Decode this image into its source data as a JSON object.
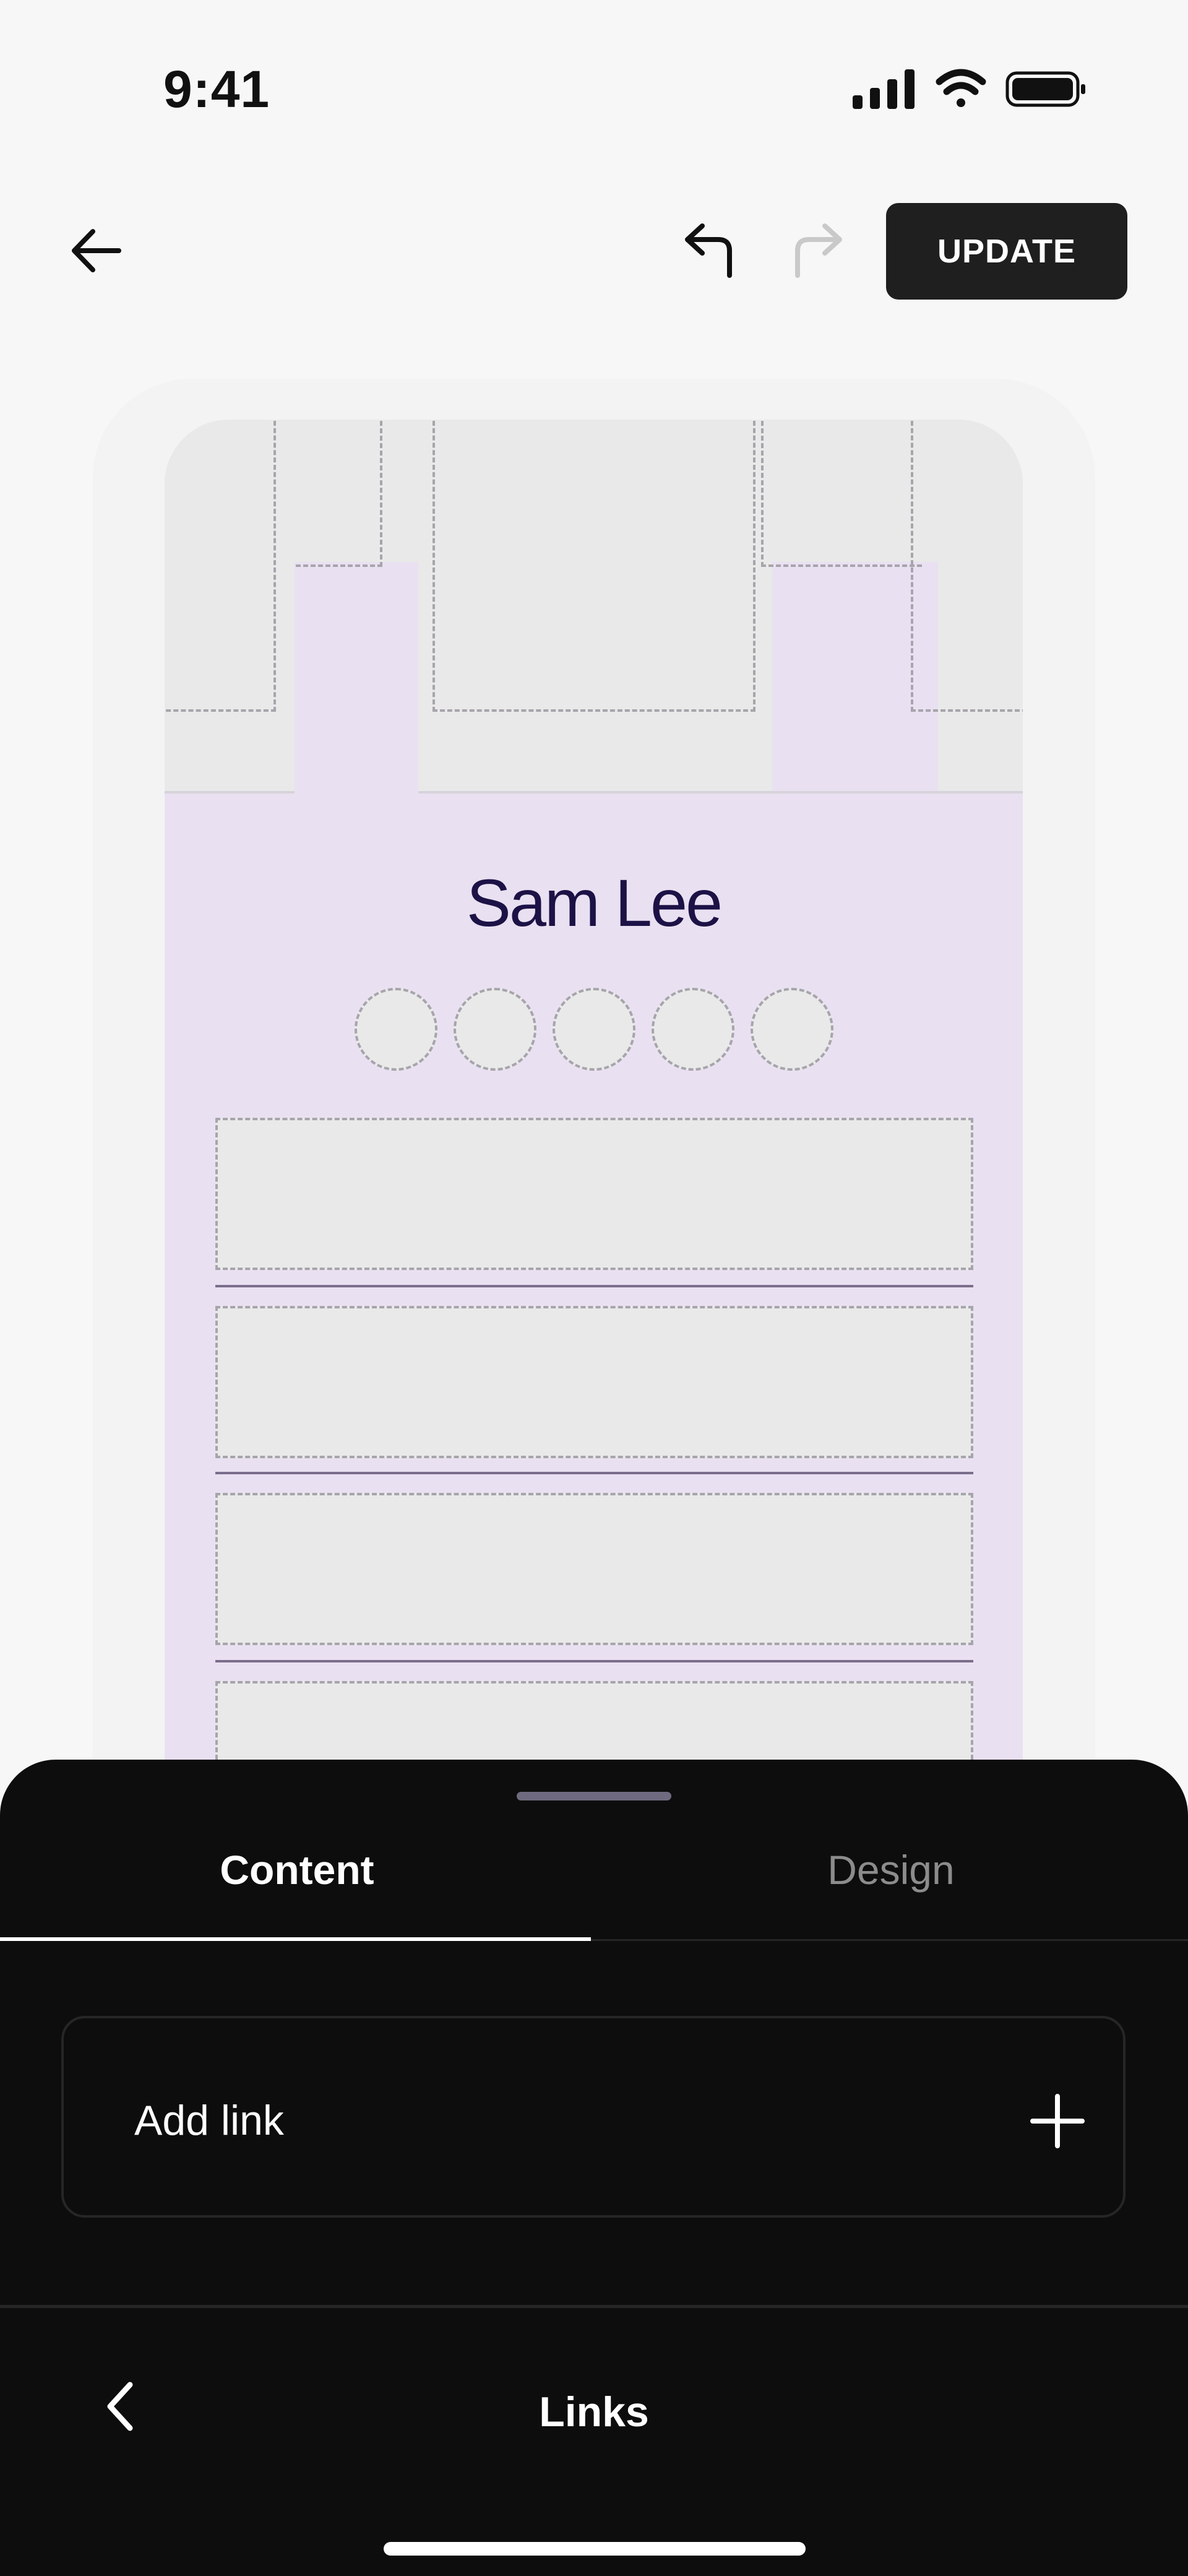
{
  "status_bar": {
    "time": "9:41",
    "icons": [
      "signal-icon",
      "wifi-icon",
      "battery-icon"
    ]
  },
  "toolbar": {
    "back_icon": "arrow-left-icon",
    "undo_icon": "undo-icon",
    "redo_icon": "redo-icon",
    "update_label": "UPDATE",
    "redo_enabled": false
  },
  "preview": {
    "profile_name": "Sam Lee",
    "social_placeholder_count": 5,
    "link_placeholder_count": 4,
    "colors": {
      "background": "#e9e0f2",
      "name": "#1c1246",
      "placeholder": "#e8e9e8",
      "dash": "#a8a4ab"
    }
  },
  "sheet": {
    "tabs": [
      {
        "label": "Content",
        "active": true
      },
      {
        "label": "Design",
        "active": false
      }
    ],
    "add_link_label": "Add link",
    "add_link_icon": "plus-icon",
    "nav_title": "Links",
    "nav_back_icon": "chevron-left-icon"
  }
}
